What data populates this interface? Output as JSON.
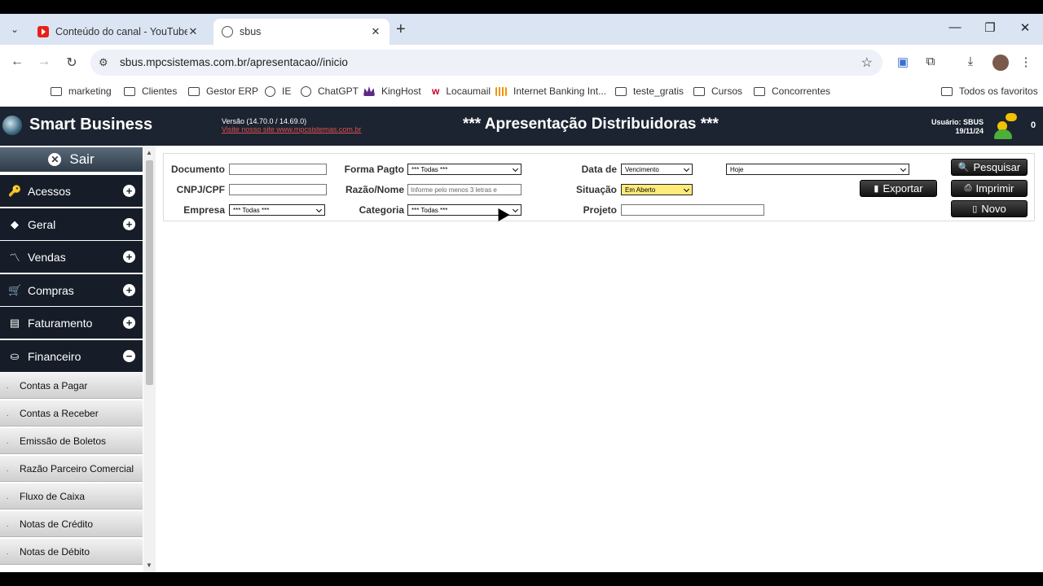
{
  "browser": {
    "tabs": [
      {
        "title": "Conteúdo do canal - YouTube S",
        "favicon": "youtube-icon",
        "active": false
      },
      {
        "title": "sbus",
        "favicon": "globe-icon",
        "active": true
      }
    ],
    "url": "sbus.mpcsistemas.com.br/apresentacao//inicio",
    "bookmarks": [
      {
        "label": "marketing",
        "icon": "folder-icon"
      },
      {
        "label": "Clientes",
        "icon": "folder-icon"
      },
      {
        "label": "Gestor ERP",
        "icon": "folder-icon"
      },
      {
        "label": "IE",
        "icon": "globe-icon"
      },
      {
        "label": "ChatGPT",
        "icon": "chatgpt-icon"
      },
      {
        "label": "KingHost",
        "icon": "kinghost-icon"
      },
      {
        "label": "Locaumail",
        "icon": "locaweb-icon"
      },
      {
        "label": "Internet Banking Int...",
        "icon": "bank-icon"
      },
      {
        "label": "teste_gratis",
        "icon": "folder-icon"
      },
      {
        "label": "Cursos",
        "icon": "folder-icon"
      },
      {
        "label": "Concorrentes",
        "icon": "folder-icon"
      }
    ],
    "all_bookmarks": "Todos os favoritos"
  },
  "header": {
    "app_name": "Smart Business",
    "version": "Versão (14.70.0 / 14.69.0)",
    "site_link": "Visite nosso site www.mpcsistemas.com.br",
    "page_title": "*** Apresentação Distribuidoras ***",
    "user": "Usuário: SBUS",
    "date": "19/11/24",
    "notifications": "0"
  },
  "sidebar": {
    "exit_label": "Sair",
    "menu": [
      {
        "label": "Acessos",
        "icon": "key-icon",
        "toggle": "+"
      },
      {
        "label": "Geral",
        "icon": "cube-icon",
        "toggle": "+"
      },
      {
        "label": "Vendas",
        "icon": "chart-icon",
        "toggle": "+"
      },
      {
        "label": "Compras",
        "icon": "cart-icon",
        "toggle": "+"
      },
      {
        "label": "Faturamento",
        "icon": "document-icon",
        "toggle": "+"
      },
      {
        "label": "Financeiro",
        "icon": "money-icon",
        "toggle": "−"
      }
    ],
    "submenu": [
      {
        "label": "Contas a Pagar"
      },
      {
        "label": "Contas a Receber"
      },
      {
        "label": "Emissão de Boletos"
      },
      {
        "label": "Razão Parceiro Comercial"
      },
      {
        "label": "Fluxo de Caixa"
      },
      {
        "label": "Notas de Crédito"
      },
      {
        "label": "Notas de Débito"
      }
    ]
  },
  "filters": {
    "documento": {
      "label": "Documento",
      "value": ""
    },
    "cnpj": {
      "label": "CNPJ/CPF",
      "value": ""
    },
    "empresa": {
      "label": "Empresa",
      "value": "*** Todas ***"
    },
    "forma_pagto": {
      "label": "Forma Pagto",
      "value": "*** Todas ***"
    },
    "razao_nome": {
      "label": "Razão/Nome",
      "placeholder": "Informe pelo menos 3 letras e"
    },
    "categoria": {
      "label": "Categoria",
      "value": "*** Todas ***"
    },
    "data_de": {
      "label": "Data de",
      "value": "Vencimento",
      "period": "Hoje"
    },
    "situacao": {
      "label": "Situação",
      "value": "Em Aberto"
    },
    "projeto": {
      "label": "Projeto",
      "value": ""
    }
  },
  "buttons": {
    "pesquisar": "Pesquisar",
    "imprimir": "Imprimir",
    "novo": "Novo",
    "exportar": "Exportar"
  }
}
